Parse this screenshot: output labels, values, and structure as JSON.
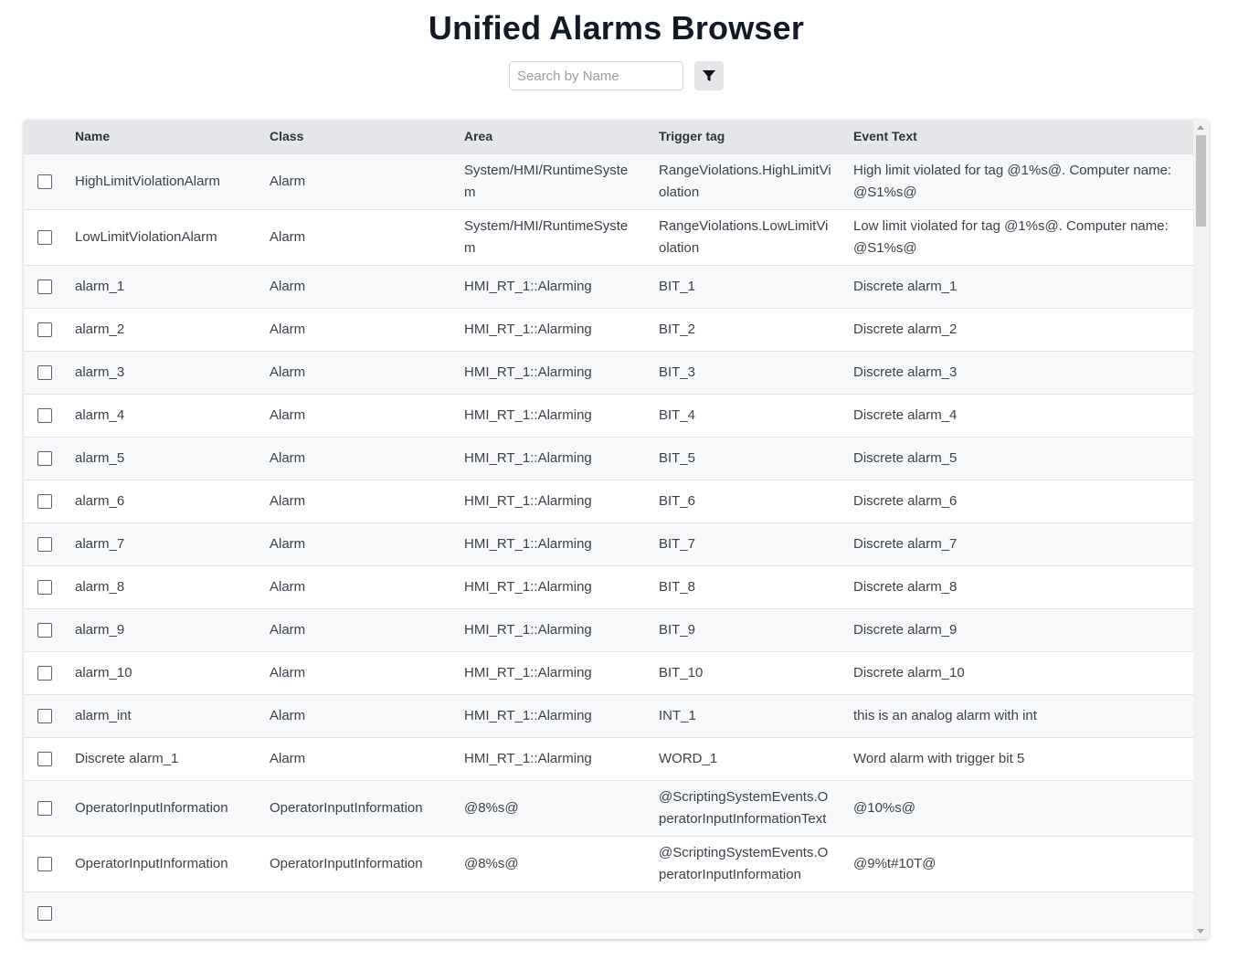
{
  "header": {
    "title": "Unified Alarms Browser"
  },
  "search": {
    "placeholder": "Search by Name",
    "value": ""
  },
  "filter": {
    "icon": "filter-icon"
  },
  "table": {
    "columns": [
      "",
      "Name",
      "Class",
      "Area",
      "Trigger tag",
      "Event Text"
    ],
    "rows": [
      {
        "name": "HighLimitViolationAlarm",
        "class": "Alarm",
        "area": "System/HMI/RuntimeSystem",
        "trigger": "RangeViolations.HighLimitViolation",
        "event": "High limit violated for tag @1%s@. Computer name: @S1%s@"
      },
      {
        "name": "LowLimitViolationAlarm",
        "class": "Alarm",
        "area": "System/HMI/RuntimeSystem",
        "trigger": "RangeViolations.LowLimitViolation",
        "event": "Low limit violated for tag @1%s@. Computer name: @S1%s@"
      },
      {
        "name": "alarm_1",
        "class": "Alarm",
        "area": "HMI_RT_1::Alarming",
        "trigger": "BIT_1",
        "event": "Discrete alarm_1"
      },
      {
        "name": "alarm_2",
        "class": "Alarm",
        "area": "HMI_RT_1::Alarming",
        "trigger": "BIT_2",
        "event": "Discrete alarm_2"
      },
      {
        "name": "alarm_3",
        "class": "Alarm",
        "area": "HMI_RT_1::Alarming",
        "trigger": "BIT_3",
        "event": "Discrete alarm_3"
      },
      {
        "name": "alarm_4",
        "class": "Alarm",
        "area": "HMI_RT_1::Alarming",
        "trigger": "BIT_4",
        "event": "Discrete alarm_4"
      },
      {
        "name": "alarm_5",
        "class": "Alarm",
        "area": "HMI_RT_1::Alarming",
        "trigger": "BIT_5",
        "event": "Discrete alarm_5"
      },
      {
        "name": "alarm_6",
        "class": "Alarm",
        "area": "HMI_RT_1::Alarming",
        "trigger": "BIT_6",
        "event": "Discrete alarm_6"
      },
      {
        "name": "alarm_7",
        "class": "Alarm",
        "area": "HMI_RT_1::Alarming",
        "trigger": "BIT_7",
        "event": "Discrete alarm_7"
      },
      {
        "name": "alarm_8",
        "class": "Alarm",
        "area": "HMI_RT_1::Alarming",
        "trigger": "BIT_8",
        "event": "Discrete alarm_8"
      },
      {
        "name": "alarm_9",
        "class": "Alarm",
        "area": "HMI_RT_1::Alarming",
        "trigger": "BIT_9",
        "event": "Discrete alarm_9"
      },
      {
        "name": "alarm_10",
        "class": "Alarm",
        "area": "HMI_RT_1::Alarming",
        "trigger": "BIT_10",
        "event": "Discrete alarm_10"
      },
      {
        "name": "alarm_int",
        "class": "Alarm",
        "area": "HMI_RT_1::Alarming",
        "trigger": "INT_1",
        "event": "this is an analog alarm with int"
      },
      {
        "name": "Discrete alarm_1",
        "class": "Alarm",
        "area": "HMI_RT_1::Alarming",
        "trigger": "WORD_1",
        "event": "Word alarm with trigger bit 5"
      },
      {
        "name": "OperatorInputInformation",
        "class": "OperatorInputInformation",
        "area": "@8%s@",
        "trigger": "@ScriptingSystemEvents.OperatorInputInformationText",
        "event": "@10%s@"
      },
      {
        "name": "OperatorInputInformation",
        "class": "OperatorInputInformation",
        "area": "@8%s@",
        "trigger": "@ScriptingSystemEvents.OperatorInputInformation",
        "event": "@9%t#10T@"
      },
      {
        "name": "",
        "class": "",
        "area": "",
        "trigger": "",
        "event": ""
      }
    ]
  },
  "colors": {
    "header_bg": "#e4e6ea",
    "row_alt": "#f7f8f9",
    "title": "#121a26"
  }
}
